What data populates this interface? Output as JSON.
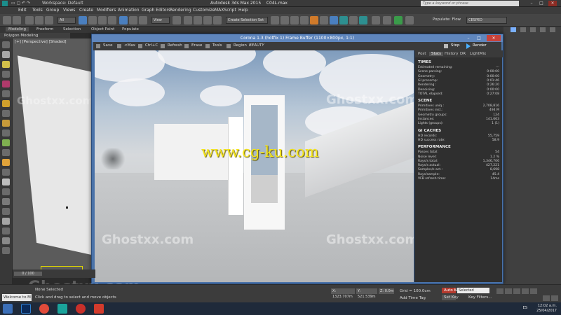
{
  "titlebar": {
    "workspace": "Workspace: Default",
    "app_title": "Autodesk 3ds Max 2015",
    "file_name": "C04L.max",
    "search_placeholder": "Type a keyword or phrase",
    "minimize": "–",
    "maximize": "□",
    "close": "×"
  },
  "menu": [
    "Edit",
    "Tools",
    "Group",
    "Views",
    "Create",
    "Modifiers",
    "Animation",
    "Graph Editors",
    "Rendering",
    "Customize",
    "MAXScript",
    "Help"
  ],
  "toolbar": {
    "selection_filter": "All",
    "view": "View",
    "named_selection": "Create Selection Set",
    "populate_label": "Populate: Flow",
    "cesped_label": "CESPED"
  },
  "ribbon": {
    "tabs": [
      "Modeling",
      "Freeform",
      "Selection",
      "Object Paint",
      "Populate"
    ],
    "active": "Modeling",
    "submenu": "Polygon Modeling"
  },
  "viewport": {
    "label": "[+] [Perspective] [Shaded]"
  },
  "framebuffer": {
    "title": "Corona 1.3 (hotfix 1) Frame Buffer (1100×800px, 1:1)",
    "tools": {
      "save": "Save",
      "max": "<Max",
      "ctrl_c": "Ctrl+C",
      "refresh": "Refresh",
      "erase": "Erase",
      "tools": "Tools",
      "region": "Region",
      "channel": "BEAUTY",
      "stop": "Stop",
      "render": "Render"
    },
    "watermark": "www.cg-ku.com",
    "watermark2": "Ghostxx.com"
  },
  "stats": {
    "tabs": [
      "Post",
      "Stats",
      "History",
      "DR",
      "LightMix"
    ],
    "active_tab": "Stats",
    "sections": [
      {
        "title": "TIMES",
        "rows": [
          {
            "k": "Estimated remaining:",
            "v": "---"
          },
          {
            "k": "Scene parsing:",
            "v": "0:00:00"
          },
          {
            "k": "Geometry:",
            "v": "0:00:00"
          },
          {
            "k": "GI precomp:",
            "v": "0:01:46"
          },
          {
            "k": "Rendering:",
            "v": "0:26:20"
          },
          {
            "k": "Denoising:",
            "v": "0:00:00"
          },
          {
            "k": "TOTAL elapsed:",
            "v": "0:27:08"
          }
        ]
      },
      {
        "title": "SCENE",
        "rows": [
          {
            "k": "Primitives uniq.:",
            "v": "2,708,816"
          },
          {
            "k": "Primitives inst.:",
            "v": "494 M"
          },
          {
            "k": "Geometry groups:",
            "v": "124"
          },
          {
            "k": "Instances:",
            "v": "141,663"
          },
          {
            "k": "Lights (groups):",
            "v": "1 (1)"
          }
        ]
      },
      {
        "title": "GI CACHES",
        "rows": [
          {
            "k": "HD records:",
            "v": "55,759"
          },
          {
            "k": "HD success rate:",
            "v": "58.9"
          }
        ]
      },
      {
        "title": "PERFORMANCE",
        "rows": [
          {
            "k": "Passes total:",
            "v": "54"
          },
          {
            "k": "Noise level:",
            "v": "1.2 %"
          },
          {
            "k": "Rays/s total:",
            "v": "1,346,706"
          },
          {
            "k": "Rays/s actual:",
            "v": "427,221"
          },
          {
            "k": "Samples/s act.:",
            "v": "8,698"
          },
          {
            "k": "Rays/sample:",
            "v": "45.4"
          },
          {
            "k": "VFB refresh time:",
            "v": "14ms"
          }
        ]
      }
    ]
  },
  "timeline": {
    "frame": "0 / 100"
  },
  "status": {
    "welcome": "Welcome to M",
    "selection": "None Selected",
    "hint": "Click and drag to select and move objects",
    "x": "X: 1323.707m",
    "y": "Y: 521.539m",
    "z": "Z: 0.0m",
    "grid": "Grid = 100.0cm",
    "time_tag": "Add Time Tag",
    "auto_key": "Auto Key",
    "set_key": "Set Key",
    "selected": "Selected",
    "key_filters": "Key Filters..."
  },
  "taskbar": {
    "lang": "ES",
    "time": "12:02 a.m.",
    "date": "25/04/2017"
  }
}
